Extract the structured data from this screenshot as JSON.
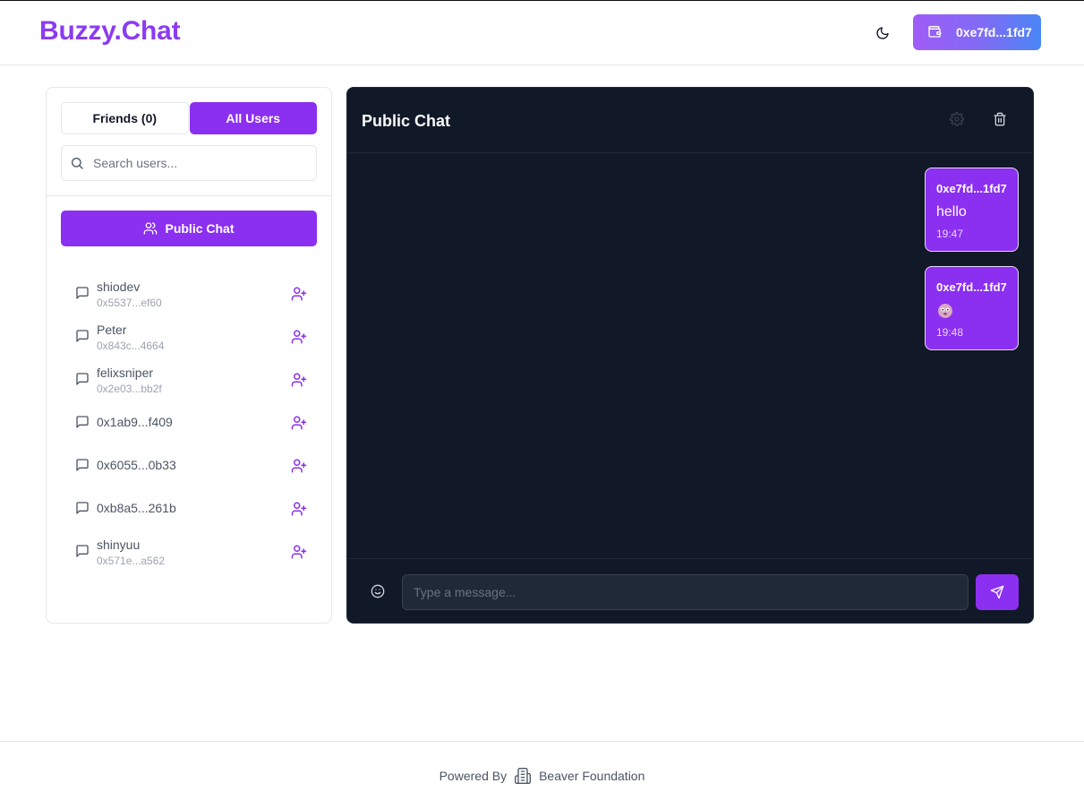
{
  "header": {
    "brand": "Buzzy.Chat",
    "wallet_label": "0xe7fd...1fd7"
  },
  "sidebar": {
    "tabs": [
      {
        "label": "Friends (0)",
        "active": false
      },
      {
        "label": "All Users",
        "active": true
      }
    ],
    "search_placeholder": "Search users...",
    "public_chat_label": "Public Chat",
    "users": [
      {
        "name": "shiodev",
        "address": "0x5537...ef60"
      },
      {
        "name": "Peter",
        "address": "0x843c...4664"
      },
      {
        "name": "felixsniper",
        "address": "0x2e03...bb2f"
      },
      {
        "name": "0x1ab9...f409",
        "address": ""
      },
      {
        "name": "0x6055...0b33",
        "address": ""
      },
      {
        "name": "0xb8a5...261b",
        "address": ""
      },
      {
        "name": "shinyuu",
        "address": "0x571e...a562"
      }
    ]
  },
  "chat": {
    "title": "Public Chat",
    "messages": [
      {
        "from": "0xe7fd...1fd7",
        "text": "hello",
        "time": "19:47"
      },
      {
        "from": "0xe7fd...1fd7",
        "emoji": "face-emoji",
        "time": "19:48"
      }
    ],
    "input_placeholder": "Type a message..."
  },
  "footer": {
    "powered_by": "Powered By",
    "org": "Beaver Foundation"
  },
  "colors": {
    "accent": "#8b2ff0",
    "brand": "#8b3cf0",
    "chat_bg": "#111827"
  }
}
